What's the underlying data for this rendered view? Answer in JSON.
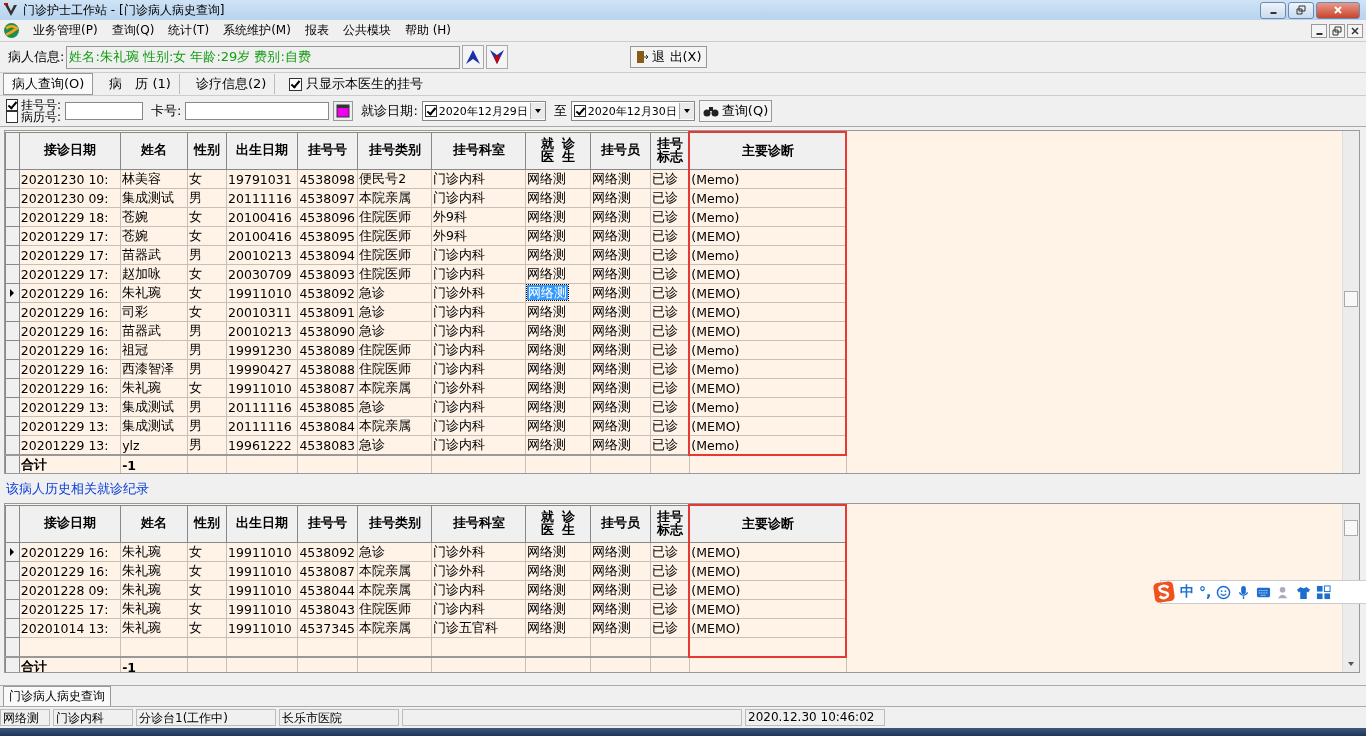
{
  "window": {
    "title": "门诊护士工作站 - [门诊病人病史查询]"
  },
  "menu": [
    "业务管理(P)",
    "查询(Q)",
    "统计(T)",
    "系统维护(M)",
    "报表",
    "公共模块",
    "帮助 (H)"
  ],
  "patient": {
    "label": "病人信息:",
    "value": "姓名:朱礼琬 性别:女 年龄:29岁 费别:自费",
    "exit": "退 出(X)"
  },
  "tabs": [
    {
      "label": "病人查询(O)",
      "selected": true
    },
    {
      "label": "病　历 (1)",
      "selected": false
    },
    {
      "label": "诊疗信息(2)",
      "selected": false
    }
  ],
  "only_mine": {
    "label": "只显示本医生的挂号",
    "checked": true
  },
  "filters": {
    "id_options": [
      {
        "label": "挂号号:",
        "checked": true
      },
      {
        "label": "病历号:",
        "checked": false
      }
    ],
    "card_label": "卡号:",
    "date_label": "就诊日期:",
    "date_from": {
      "value": "2020年12月29日",
      "checked": true
    },
    "to_label": "至",
    "date_to": {
      "value": "2020年12月30日",
      "checked": true
    },
    "query": "查询(Q)"
  },
  "table": {
    "columns": [
      "接诊日期",
      "姓名",
      "性别",
      "出生日期",
      "挂号号",
      "挂号类别",
      "挂号科室",
      "就诊医生",
      "挂号员",
      "挂号标志",
      "主要诊断"
    ],
    "rows": [
      {
        "cells": [
          "20201230 10:",
          "林美容",
          "女",
          "19791031",
          "4538098",
          "便民号2",
          "门诊内科",
          "网络测",
          "网络测",
          "已诊",
          "(Memo)"
        ],
        "selected": false
      },
      {
        "cells": [
          "20201230 09:",
          "集成测试",
          "男",
          "20111116",
          "4538097",
          "本院亲属",
          "门诊内科",
          "网络测",
          "网络测",
          "已诊",
          "(Memo)"
        ],
        "selected": false
      },
      {
        "cells": [
          "20201229 18:",
          "苍婉",
          "女",
          "20100416",
          "4538096",
          "住院医师",
          "外9科",
          "网络测",
          "网络测",
          "已诊",
          "(Memo)"
        ],
        "selected": false
      },
      {
        "cells": [
          "20201229 17:",
          "苍婉",
          "女",
          "20100416",
          "4538095",
          "住院医师",
          "外9科",
          "网络测",
          "网络测",
          "已诊",
          "(MEMO)"
        ],
        "selected": false
      },
      {
        "cells": [
          "20201229 17:",
          "苗器武",
          "男",
          "20010213",
          "4538094",
          "住院医师",
          "门诊内科",
          "网络测",
          "网络测",
          "已诊",
          "(Memo)"
        ],
        "selected": false
      },
      {
        "cells": [
          "20201229 17:",
          "赵加咏",
          "女",
          "20030709",
          "4538093",
          "住院医师",
          "门诊内科",
          "网络测",
          "网络测",
          "已诊",
          "(MEMO)"
        ],
        "selected": false
      },
      {
        "cells": [
          "20201229 16:",
          "朱礼琬",
          "女",
          "19911010",
          "4538092",
          "急诊",
          "门诊外科",
          "网络测",
          "网络测",
          "已诊",
          "(MEMO)"
        ],
        "selected": true
      },
      {
        "cells": [
          "20201229 16:",
          "司彩",
          "女",
          "20010311",
          "4538091",
          "急诊",
          "门诊内科",
          "网络测",
          "网络测",
          "已诊",
          "(MEMO)"
        ],
        "selected": false
      },
      {
        "cells": [
          "20201229 16:",
          "苗器武",
          "男",
          "20010213",
          "4538090",
          "急诊",
          "门诊内科",
          "网络测",
          "网络测",
          "已诊",
          "(MEMO)"
        ],
        "selected": false
      },
      {
        "cells": [
          "20201229 16:",
          "祖冠",
          "男",
          "19991230",
          "4538089",
          "住院医师",
          "门诊内科",
          "网络测",
          "网络测",
          "已诊",
          "(Memo)"
        ],
        "selected": false
      },
      {
        "cells": [
          "20201229 16:",
          "西漆智泽",
          "男",
          "19990427",
          "4538088",
          "住院医师",
          "门诊内科",
          "网络测",
          "网络测",
          "已诊",
          "(Memo)"
        ],
        "selected": false
      },
      {
        "cells": [
          "20201229 16:",
          "朱礼琬",
          "女",
          "19911010",
          "4538087",
          "本院亲属",
          "门诊外科",
          "网络测",
          "网络测",
          "已诊",
          "(MEMO)"
        ],
        "selected": false
      },
      {
        "cells": [
          "20201229 13:",
          "集成测试",
          "男",
          "20111116",
          "4538085",
          "急诊",
          "门诊内科",
          "网络测",
          "网络测",
          "已诊",
          "(Memo)"
        ],
        "selected": false
      },
      {
        "cells": [
          "20201229 13:",
          "集成测试",
          "男",
          "20111116",
          "4538084",
          "本院亲属",
          "门诊内科",
          "网络测",
          "网络测",
          "已诊",
          "(MEMO)"
        ],
        "selected": false
      },
      {
        "cells": [
          "20201229 13:",
          "ylz",
          "男",
          "19961222",
          "4538083",
          "急诊",
          "门诊内科",
          "网络测",
          "网络测",
          "已诊",
          "(Memo)"
        ],
        "selected": false
      }
    ],
    "total_label": "合计",
    "total_value": "-1"
  },
  "history_title": "该病人历史相关就诊纪录",
  "history": {
    "columns": [
      "接诊日期",
      "姓名",
      "性别",
      "出生日期",
      "挂号号",
      "挂号类别",
      "挂号科室",
      "就诊医生",
      "挂号员",
      "挂号标志",
      "主要诊断"
    ],
    "rows": [
      {
        "cells": [
          "20201229 16:",
          "朱礼琬",
          "女",
          "19911010",
          "4538092",
          "急诊",
          "门诊外科",
          "网络测",
          "网络测",
          "已诊",
          "(MEMO)"
        ],
        "selected": true
      },
      {
        "cells": [
          "20201229 16:",
          "朱礼琬",
          "女",
          "19911010",
          "4538087",
          "本院亲属",
          "门诊外科",
          "网络测",
          "网络测",
          "已诊",
          "(MEMO)"
        ],
        "selected": false
      },
      {
        "cells": [
          "20201228 09:",
          "朱礼琬",
          "女",
          "19911010",
          "4538044",
          "本院亲属",
          "门诊内科",
          "网络测",
          "网络测",
          "已诊",
          "(MEMO)"
        ],
        "selected": false
      },
      {
        "cells": [
          "20201225 17:",
          "朱礼琬",
          "女",
          "19911010",
          "4538043",
          "住院医师",
          "门诊内科",
          "网络测",
          "网络测",
          "已诊",
          "(MEMO)"
        ],
        "selected": false
      },
      {
        "cells": [
          "20201014 13:",
          "朱礼琬",
          "女",
          "19911010",
          "4537345",
          "本院亲属",
          "门诊五官科",
          "网络测",
          "网络测",
          "已诊",
          "(MEMO)"
        ],
        "selected": false
      }
    ],
    "total_label": "合计",
    "total_value": "-1"
  },
  "ime": {
    "mode": "中",
    "punct": "°,"
  },
  "bottom_tab": "门诊病人病史查询",
  "status_bar": [
    "网络测",
    "门诊内科",
    "分诊台1(工作中)",
    "长乐市医院",
    "2020.12.30 10:46:02"
  ]
}
